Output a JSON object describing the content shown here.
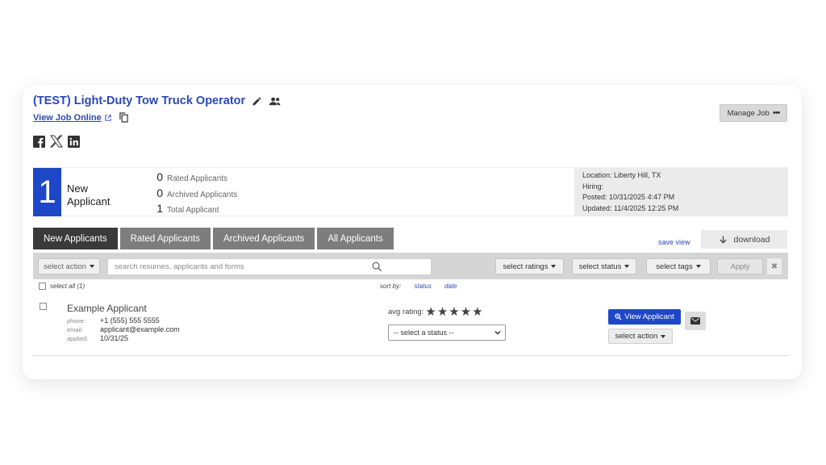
{
  "job": {
    "title": "(TEST) Light-Duty Tow Truck Operator",
    "view_online": "View Job Online",
    "manage_label": "Manage Job"
  },
  "social": [
    "facebook-icon",
    "x-icon",
    "linkedin-icon"
  ],
  "summary": {
    "new_count": "1",
    "new_label_1": "New",
    "new_label_2": "Applicant",
    "rated_count": "0",
    "rated_label": "Rated Applicants",
    "archived_count": "0",
    "archived_label": "Archived Applicants",
    "total_count": "1",
    "total_label": "Total Applicant"
  },
  "info": {
    "location": "Location: Liberty Hill, TX",
    "hiring": "Hiring:",
    "posted": "Posted: 10/31/2025 4:47 PM",
    "updated": "Updated: 11/4/2025 12:25 PM"
  },
  "tabs": [
    {
      "label": "New Applicants",
      "active": true
    },
    {
      "label": "Rated Applicants",
      "active": false
    },
    {
      "label": "Archived Applicants",
      "active": false
    },
    {
      "label": "All Applicants",
      "active": false
    }
  ],
  "save_view": "save view",
  "download": "download",
  "toolbar": {
    "select_action": "select action",
    "search_placeholder": "search resumes, applicants and forms",
    "select_ratings": "select ratings",
    "select_status": "select status",
    "select_tags": "select tags",
    "apply": "Apply",
    "clear": "✖"
  },
  "list": {
    "select_all": "select all (1)",
    "sort_by": "sort by:",
    "sort_status": "status",
    "sort_date": "date"
  },
  "applicant": {
    "name": "Example Applicant",
    "phone_label": "phone:",
    "phone": "+1 (555) 555 5555",
    "email_label": "email:",
    "email": "applicant@example.com",
    "applied_label": "applied:",
    "applied": "10/31/25",
    "avg_rating_label": "avg rating:",
    "rating": 0,
    "stars": "★★★★★",
    "status_placeholder": "-- select a status --",
    "view_button": "View Applicant",
    "action_button": "select action"
  },
  "colors": {
    "accent": "#1e47c8",
    "link": "#2a49b8",
    "tab_active": "#3a3a3a",
    "tab_inactive": "#7d7d7d"
  }
}
